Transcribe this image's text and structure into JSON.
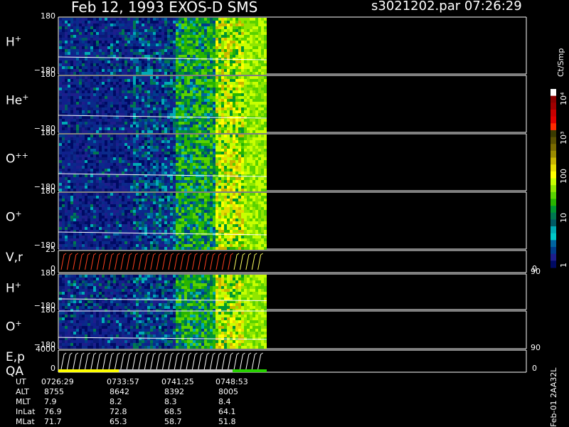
{
  "header": {
    "title": "Feb 12, 1993   EXOS-D SMS",
    "file": "s3021202.par  07:26:29"
  },
  "panels": [
    {
      "id": "h1",
      "base": "H",
      "sup": "+",
      "top_tick": "180",
      "bot_tick": "−180"
    },
    {
      "id": "he",
      "base": "He",
      "sup": "+",
      "top_tick": "180",
      "bot_tick": "−180"
    },
    {
      "id": "o2",
      "base": "O",
      "sup": "++",
      "top_tick": "180",
      "bot_tick": "−180"
    },
    {
      "id": "o1",
      "base": "O",
      "sup": "+",
      "top_tick": "180",
      "bot_tick": "−180"
    },
    {
      "id": "vr",
      "base": "V,r",
      "sup": "",
      "top_tick": "25",
      "bot_tick": "0",
      "right_top": "90",
      "right_bot": "0"
    },
    {
      "id": "h2",
      "base": "H",
      "sup": "+",
      "top_tick": "180",
      "bot_tick": "−180"
    },
    {
      "id": "o3",
      "base": "O",
      "sup": "+",
      "top_tick": "180",
      "bot_tick": "−180",
      "right_top": "90"
    },
    {
      "id": "ep",
      "base": "E,p",
      "sup": "",
      "base2": "QA",
      "top_tick": "4000",
      "bot_tick": "0",
      "right_bot": "0"
    }
  ],
  "colorbar": {
    "unit": "Ct/Smp",
    "labels": [
      "10⁴",
      "10³",
      "100",
      "10",
      "1"
    ],
    "colors": [
      "#ffffff",
      "#8b0000",
      "#a00000",
      "#c80000",
      "#e00000",
      "#ff2a00",
      "#3a3a00",
      "#5a5000",
      "#7a6a00",
      "#9a8a00",
      "#c8b400",
      "#e6dc00",
      "#ffff00",
      "#c8ff00",
      "#90e600",
      "#5ad200",
      "#28b400",
      "#009632",
      "#007850",
      "#005a64",
      "#00aab4",
      "#00c8c8",
      "#0064a0",
      "#003c8c",
      "#1e1e8c",
      "#000a64"
    ]
  },
  "footer": {
    "rows": [
      {
        "label": "UT",
        "values": [
          "0726:29",
          "0733:57",
          "0741:25",
          "0748:53"
        ]
      },
      {
        "label": "ALT",
        "values": [
          "8755",
          "8642",
          "8392",
          "8005"
        ]
      },
      {
        "label": "MLT",
        "values": [
          "7.9",
          "8.2",
          "8.3",
          "8.4"
        ]
      },
      {
        "label": "InLat",
        "values": [
          "76.9",
          "72.8",
          "68.5",
          "64.1"
        ]
      },
      {
        "label": "MLat",
        "values": [
          "71.7",
          "65.3",
          "58.7",
          "51.8"
        ]
      }
    ],
    "side_text": "Feb-01  2AA32L"
  },
  "chart_data": {
    "type": "heatmap",
    "title": "Feb 12, 1993   EXOS-D SMS",
    "x_ticks": [
      "0726:29",
      "0733:57",
      "0741:25",
      "0748:53"
    ],
    "panels": [
      "H+",
      "He+",
      "O++",
      "O+",
      "V,r",
      "H+",
      "O+",
      "E,p QA"
    ],
    "colorbar_unit": "Ct/Smp",
    "colorbar_ticks": [
      "1",
      "10",
      "100",
      "10^3",
      "10^4"
    ]
  }
}
